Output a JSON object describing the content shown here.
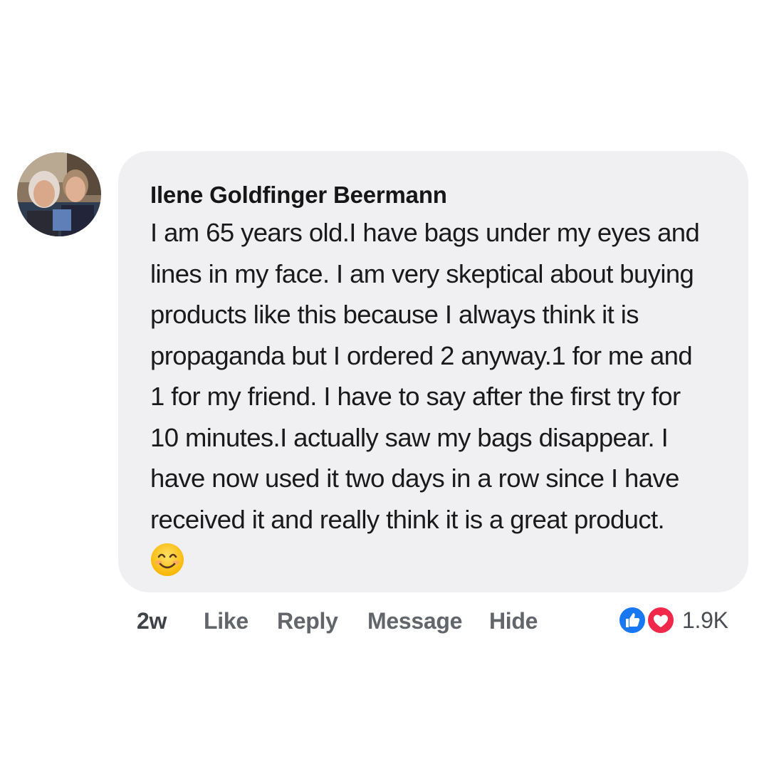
{
  "comment": {
    "author": "Ilene Goldfinger Beermann",
    "text": "I am 65 years old.I have bags under my eyes and\nlines in my face. I am very skeptical about buying\nproducts like this because I always think it is\npropaganda but I ordered 2 anyway.1 for me and\n1 for my friend. I have to say after the first try for\n10 minutes.I actually saw my bags disappear. I\nhave now used it two days in a row since I have\nreceived it and really think it is a great product.",
    "emoji_icon": "smiling-face-emoji"
  },
  "actions": {
    "timestamp": "2w",
    "like_label": "Like",
    "reply_label": "Reply",
    "message_label": "Message",
    "hide_label": "Hide"
  },
  "reactions": {
    "icons": [
      "like-icon",
      "heart-icon"
    ],
    "count": "1.9K"
  },
  "colors": {
    "bubble_background": "#f0f0f2",
    "like_blue": "#1877f2",
    "heart_red": "#f02849",
    "action_gray": "#62666b"
  }
}
